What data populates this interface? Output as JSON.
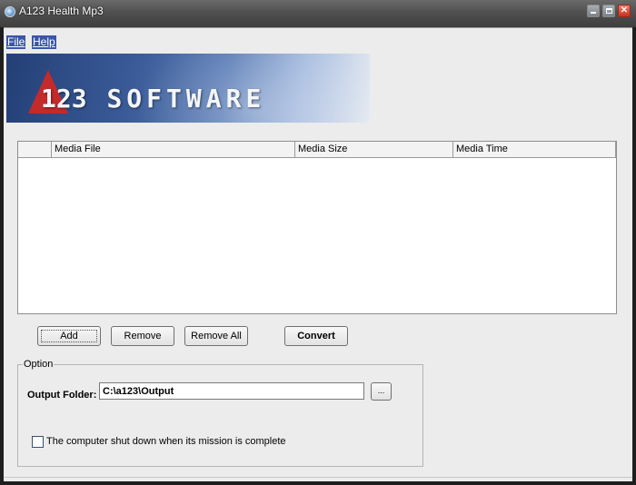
{
  "window": {
    "title": "A123 Health Mp3",
    "app_icon": "globe-icon",
    "controls": {
      "minimize": "minimize-icon",
      "maximize": "maximize-icon",
      "close": "close-icon",
      "close_glyph": "✕"
    }
  },
  "menu": {
    "items": [
      {
        "label": "File"
      },
      {
        "label": "Help"
      }
    ]
  },
  "banner": {
    "logo_letter": "A",
    "numbers": "123",
    "text": "SOFTWARE"
  },
  "list": {
    "columns": [
      {
        "label": ""
      },
      {
        "label": "Media File"
      },
      {
        "label": "Media Size"
      },
      {
        "label": "Media Time"
      }
    ],
    "rows": []
  },
  "buttons": {
    "add": "Add",
    "remove": "Remove",
    "remove_all": "Remove All",
    "convert": "Convert"
  },
  "options": {
    "group_label": "Option",
    "output_folder_label": "Output Folder:",
    "output_folder_value": "C:\\a123\\Output",
    "browse_label": "...",
    "shutdown_label": "The computer shut down when its mission is complete",
    "shutdown_checked": false
  },
  "colors": {
    "menu_highlight": "#3b56a8",
    "close_button": "#c7321f",
    "logo_red": "#c42a2a"
  }
}
